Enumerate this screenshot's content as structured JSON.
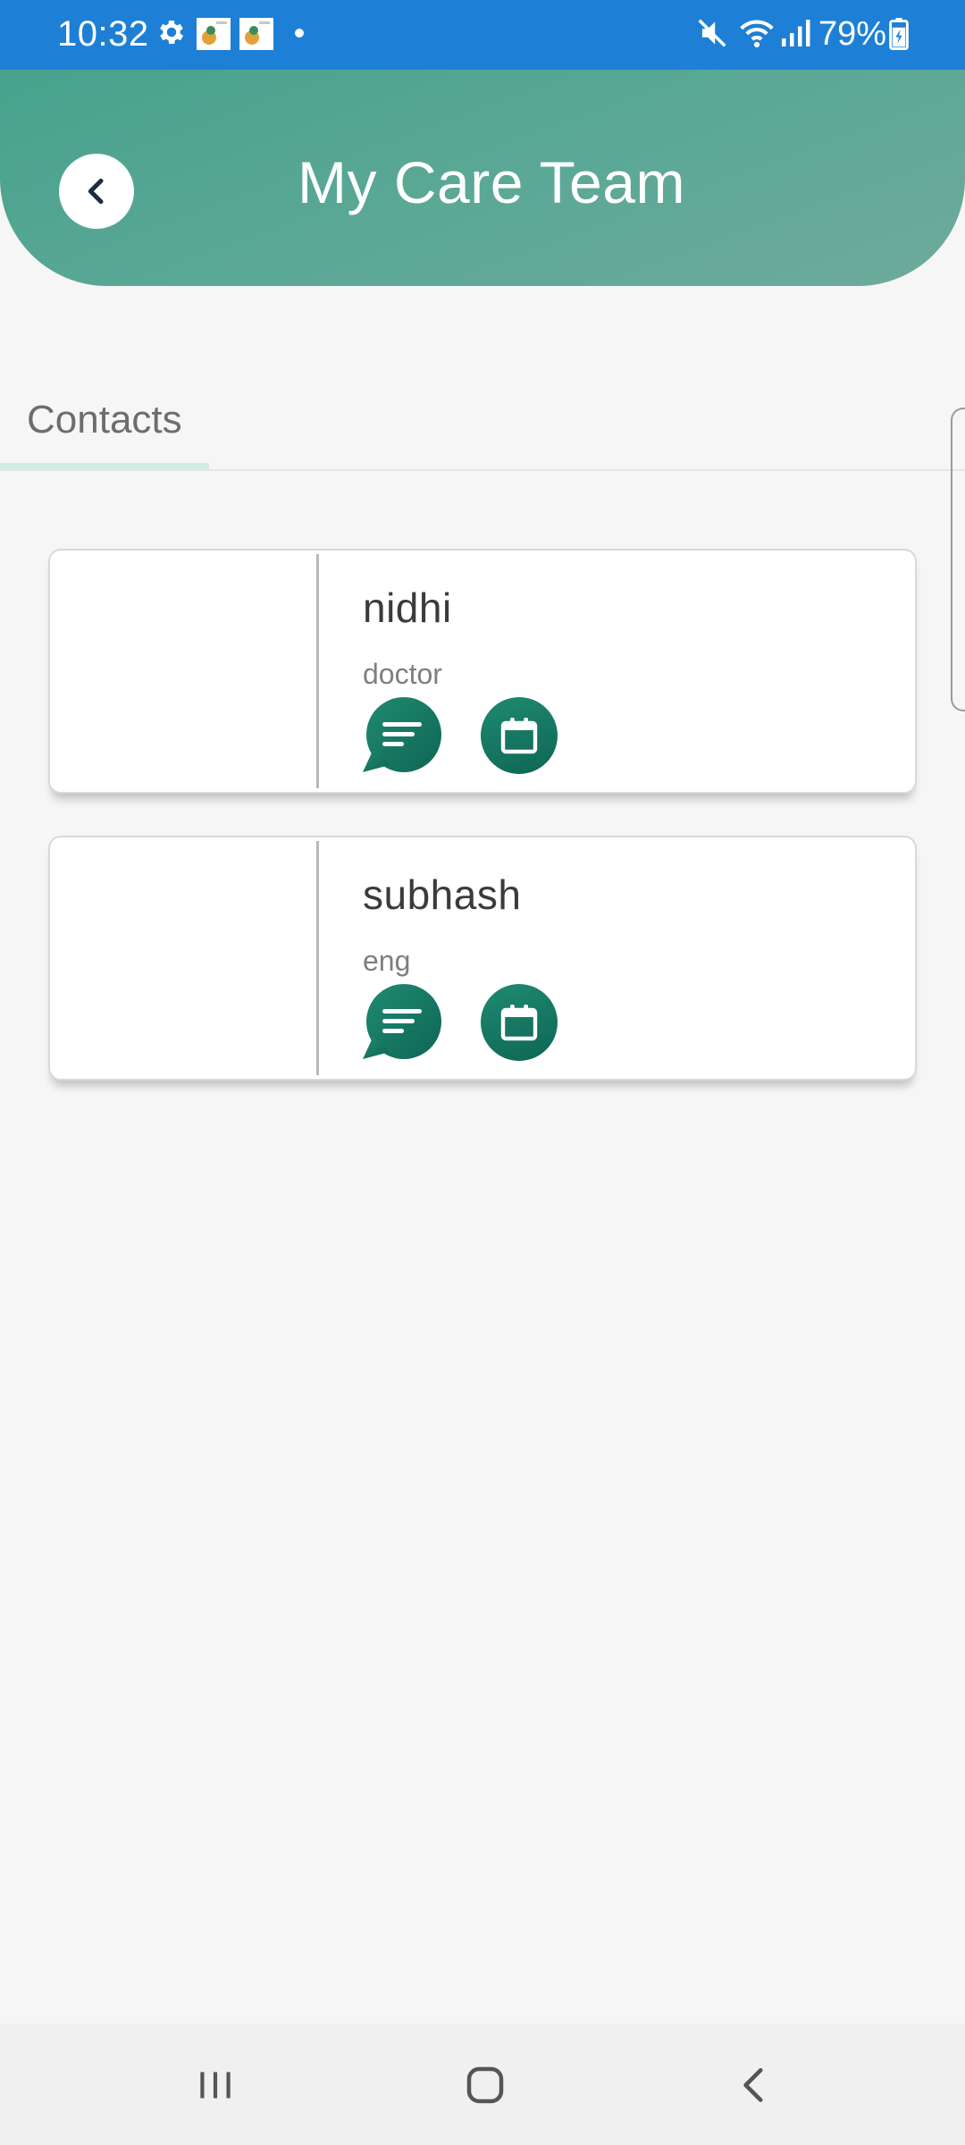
{
  "status_bar": {
    "time": "10:32",
    "battery": "79%",
    "icons": [
      "gear-icon",
      "app-notification-icon",
      "app-notification-icon",
      "dot-icon",
      "mute-icon",
      "wifi-icon",
      "signal-icon",
      "battery-icon"
    ]
  },
  "header": {
    "title": "My Care Team",
    "back_icon": "chevron-left-icon"
  },
  "tabs": [
    {
      "label": "Contacts",
      "selected": true
    }
  ],
  "contacts": [
    {
      "name": "nidhi",
      "role": "doctor",
      "actions": [
        "chat-icon",
        "calendar-icon"
      ]
    },
    {
      "name": "subhash",
      "role": "eng",
      "actions": [
        "chat-icon",
        "calendar-icon"
      ]
    }
  ],
  "navigation_bar": {
    "icons": [
      "recents-icon",
      "home-icon",
      "back-icon"
    ]
  },
  "colors": {
    "status_bar": "#1e7fd6",
    "header_gradient_start": "#47a28c",
    "header_gradient_end": "#6eaa9c",
    "action_button": "#157a64",
    "background": "#f6f6f6",
    "tab_indicator": "#d3ebe6"
  }
}
